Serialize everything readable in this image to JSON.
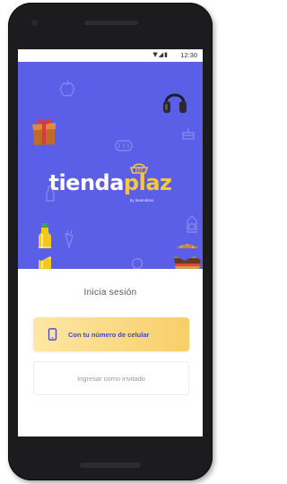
{
  "status_bar": {
    "time": "12:30",
    "icons": [
      "wifi-icon",
      "signal-icon",
      "battery-icon"
    ]
  },
  "brand": {
    "name_main": "tienda",
    "name_accent": "plaz",
    "byline": "by iteamdevs",
    "hero_color": "#5b5ee6",
    "accent_color": "#f7c83a"
  },
  "login": {
    "title": "Inicia sesión",
    "phone_button_label": "Con tu número de celular",
    "guest_button_label": "Ingresar como invitado"
  }
}
